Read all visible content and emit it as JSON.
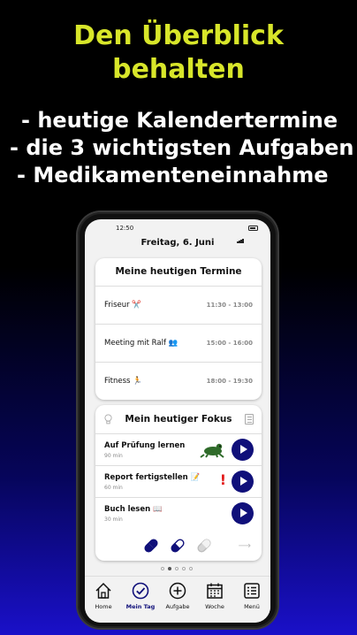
{
  "promo": {
    "headline_line1": "Den Überblick",
    "headline_line2": "behalten",
    "bullets": [
      "- heutige Kalendertermine",
      "- die 3 wichtigsten Aufgaben",
      "- Medikamenteneinnahme"
    ]
  },
  "status": {
    "time": "12:50"
  },
  "header": {
    "date": "Freitag, 6. Juni"
  },
  "termine": {
    "title": "Meine heutigen Termine",
    "items": [
      {
        "name": "Friseur ✂️",
        "time": "11:30 - 13:00"
      },
      {
        "name": "Meeting mit Ralf 👥",
        "time": "15:00 - 16:00"
      },
      {
        "name": "Fitness 🏃",
        "time": "18:00 - 19:30"
      }
    ]
  },
  "fokus": {
    "title": "Mein heutiger Fokus",
    "tasks": [
      {
        "name": "Auf Prüfung lernen",
        "duration": "90 min",
        "marker": "frog-icon"
      },
      {
        "name": "Report fertigstellen 📝",
        "duration": "60 min",
        "marker": "!"
      },
      {
        "name": "Buch lesen 📖",
        "duration": "30 min",
        "marker": ""
      }
    ],
    "medication": {
      "taken": 2,
      "total": 3,
      "arrow": "⟶"
    }
  },
  "pager": {
    "pages": 5,
    "active_index": 1
  },
  "tabs": [
    {
      "label": "Home",
      "icon": "home-icon"
    },
    {
      "label": "Mein Tag",
      "icon": "check-circle-icon"
    },
    {
      "label": "Aufgabe",
      "icon": "plus-circle-icon"
    },
    {
      "label": "Woche",
      "icon": "calendar-icon"
    },
    {
      "label": "Menü",
      "icon": "menu-list-icon"
    }
  ],
  "colors": {
    "headline": "#d8e62a",
    "accent": "#10107a",
    "alert": "#e21b1b"
  }
}
